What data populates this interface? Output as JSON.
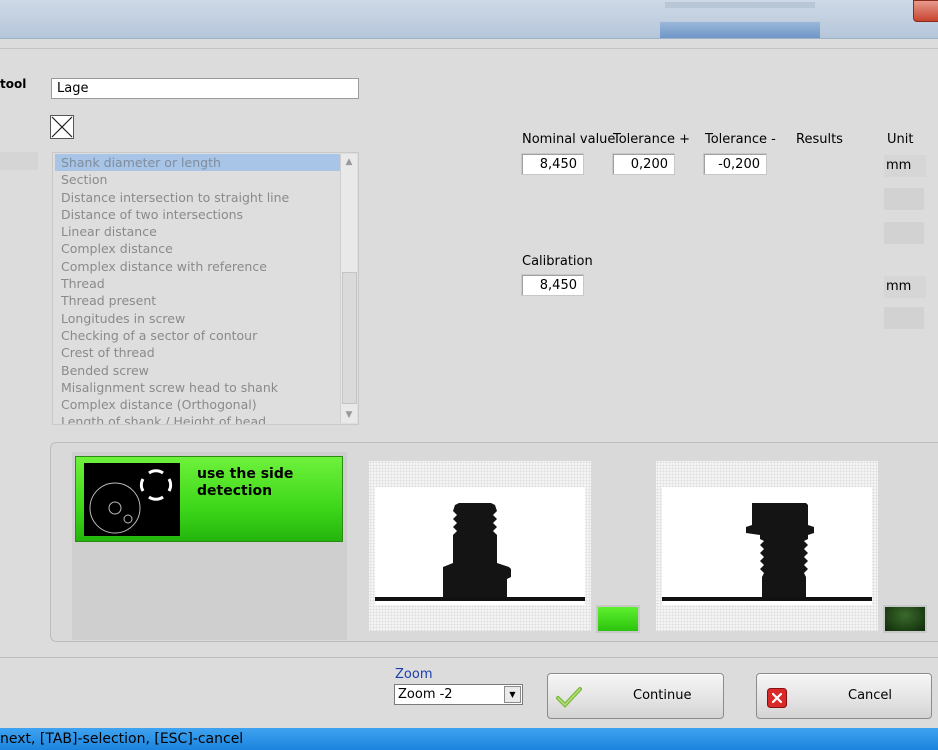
{
  "sidebar": {
    "tool_label": "tool"
  },
  "form": {
    "name_value": "Lage",
    "checkbox_checked": true
  },
  "function_list": {
    "selected_index": 0,
    "items": [
      "Shank diameter or length",
      "Section",
      "Distance intersection to straight line",
      "Distance of two intersections",
      "Linear distance",
      "Complex distance",
      "Complex distance with reference",
      "Thread",
      "Thread present",
      "Longitudes in screw",
      "Checking of a sector of contour",
      "Crest of thread",
      "Bended screw",
      "Misalignment screw head to shank",
      "Complex distance (Orthogonal)",
      "Length of shank / Height of head"
    ]
  },
  "parameters": {
    "headers": {
      "nominal": "Nominal value",
      "tol_plus": "Tolerance +",
      "tol_minus": "Tolerance -",
      "results": "Results",
      "unit": "Unit"
    },
    "nominal_value": "8,450",
    "tolerance_plus": "0,200",
    "tolerance_minus": "-0,200",
    "unit_1": "mm",
    "calibration_label": "Calibration",
    "calibration_value": "8,450",
    "unit_2": "mm"
  },
  "detection": {
    "mode_line1": "use the side",
    "mode_line2": "detection",
    "indicator1_color": "#3fdc1a",
    "indicator2_color": "#1e4214"
  },
  "zoom": {
    "label": "Zoom",
    "selected": "Zoom -2"
  },
  "buttons": {
    "continue_label": "Continue",
    "cancel_label": "Cancel"
  },
  "status": {
    "text": "next,  [TAB]-selection,  [ESC]-cancel"
  }
}
